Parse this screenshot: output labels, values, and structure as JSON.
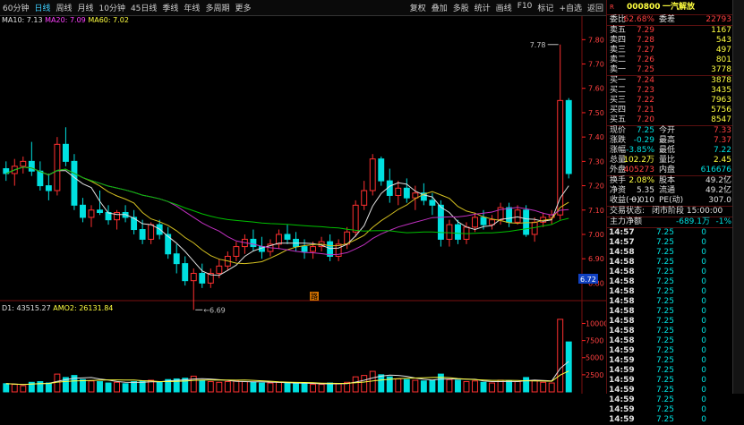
{
  "toolbar": {
    "left": [
      "60分钟",
      "日线",
      "周线",
      "月线",
      "10分钟",
      "45日线",
      "季线",
      "年线",
      "多周期",
      "更多"
    ],
    "active_index": 1,
    "right": [
      "复权",
      "叠加",
      "多股",
      "统计",
      "画线",
      "F10",
      "标记",
      "+自选",
      "返回"
    ]
  },
  "ma_legend": {
    "ma10": "MA10: 7.13",
    "ma20": "MA20: 7.09",
    "ma60": "MA60: 7.02"
  },
  "vol_legend": {
    "vol": "D1: 43515.27",
    "amo": "AMO2: 26131.84"
  },
  "colors": {
    "up": "#ff3030",
    "down": "#00e0e0",
    "ma10": "#e0e0e0",
    "ma20": "#d4c020",
    "ma60": "#00c000",
    "ma120": "#c030c0",
    "axis": "#ff2020"
  },
  "price_axis": {
    "labels": [
      "7.80",
      "7.70",
      "7.60",
      "7.50",
      "7.40",
      "7.30",
      "7.20",
      "7.10",
      "7.00",
      "6.90",
      "6.80"
    ],
    "min": 6.75,
    "max": 7.86
  },
  "vol_axis": {
    "labels": [
      "10000",
      "7500",
      "5000",
      "2500"
    ],
    "max": 11500
  },
  "annotations": {
    "high": "7.78",
    "low": "6.69",
    "current": "6.72",
    "marker": "路"
  },
  "candles": [
    [
      7.27,
      7.3,
      7.22,
      7.25,
      1200
    ],
    [
      7.25,
      7.31,
      7.2,
      7.28,
      1100
    ],
    [
      7.28,
      7.32,
      7.25,
      7.3,
      900
    ],
    [
      7.3,
      7.38,
      7.24,
      7.26,
      1400
    ],
    [
      7.26,
      7.3,
      7.18,
      7.2,
      1500
    ],
    [
      7.2,
      7.25,
      7.14,
      7.18,
      1300
    ],
    [
      7.18,
      7.4,
      7.16,
      7.37,
      2600
    ],
    [
      7.37,
      7.44,
      7.28,
      7.3,
      2100
    ],
    [
      7.3,
      7.33,
      7.1,
      7.12,
      2400
    ],
    [
      7.12,
      7.15,
      7.05,
      7.07,
      1800
    ],
    [
      7.07,
      7.12,
      7.03,
      7.1,
      1600
    ],
    [
      7.1,
      7.18,
      7.08,
      7.09,
      1500
    ],
    [
      7.09,
      7.12,
      7.04,
      7.06,
      1300
    ],
    [
      7.06,
      7.1,
      7.02,
      7.09,
      1400
    ],
    [
      7.09,
      7.12,
      7.05,
      7.07,
      1200
    ],
    [
      7.07,
      7.1,
      7.0,
      7.02,
      1500
    ],
    [
      7.02,
      7.06,
      6.96,
      6.98,
      1600
    ],
    [
      6.98,
      7.05,
      6.96,
      7.04,
      1700
    ],
    [
      7.04,
      7.06,
      6.98,
      7.0,
      1400
    ],
    [
      7.0,
      7.03,
      6.9,
      6.92,
      1800
    ],
    [
      6.92,
      6.96,
      6.84,
      6.88,
      1900
    ],
    [
      6.88,
      6.91,
      6.79,
      6.81,
      2000
    ],
    [
      6.81,
      6.86,
      6.69,
      6.84,
      2300
    ],
    [
      6.84,
      6.88,
      6.78,
      6.8,
      1700
    ],
    [
      6.8,
      6.86,
      6.78,
      6.84,
      1500
    ],
    [
      6.84,
      6.9,
      6.82,
      6.87,
      1400
    ],
    [
      6.87,
      6.93,
      6.85,
      6.91,
      1500
    ],
    [
      6.91,
      6.97,
      6.89,
      6.95,
      1600
    ],
    [
      6.95,
      7.0,
      6.92,
      6.98,
      1500
    ],
    [
      6.98,
      7.02,
      6.93,
      6.95,
      1400
    ],
    [
      6.95,
      6.99,
      6.9,
      6.93,
      1300
    ],
    [
      6.93,
      6.98,
      6.91,
      6.96,
      1300
    ],
    [
      6.96,
      7.02,
      6.94,
      7.0,
      1400
    ],
    [
      7.0,
      7.04,
      6.96,
      6.98,
      1300
    ],
    [
      6.98,
      7.01,
      6.93,
      6.95,
      1200
    ],
    [
      6.95,
      6.98,
      6.9,
      6.93,
      1200
    ],
    [
      6.93,
      6.97,
      6.9,
      6.95,
      1100
    ],
    [
      6.95,
      6.99,
      6.93,
      6.97,
      1100
    ],
    [
      6.97,
      7.0,
      6.89,
      6.91,
      1300
    ],
    [
      6.91,
      6.98,
      6.89,
      6.96,
      1200
    ],
    [
      6.96,
      7.03,
      6.94,
      7.01,
      1400
    ],
    [
      7.01,
      7.14,
      6.99,
      7.12,
      2200
    ],
    [
      7.12,
      7.22,
      7.1,
      7.18,
      2400
    ],
    [
      7.18,
      7.33,
      7.16,
      7.31,
      3000
    ],
    [
      7.31,
      7.32,
      7.2,
      7.22,
      2500
    ],
    [
      7.22,
      7.27,
      7.13,
      7.16,
      2200
    ],
    [
      7.16,
      7.22,
      7.12,
      7.19,
      1900
    ],
    [
      7.19,
      7.23,
      7.13,
      7.15,
      1800
    ],
    [
      7.15,
      7.2,
      7.1,
      7.17,
      1700
    ],
    [
      7.17,
      7.21,
      7.12,
      7.14,
      1600
    ],
    [
      7.14,
      7.17,
      7.08,
      7.12,
      1700
    ],
    [
      7.12,
      7.14,
      6.95,
      6.98,
      2600
    ],
    [
      6.98,
      7.06,
      6.95,
      7.04,
      1800
    ],
    [
      7.04,
      7.06,
      6.96,
      6.98,
      1700
    ],
    [
      6.98,
      7.05,
      6.96,
      7.03,
      1500
    ],
    [
      7.03,
      7.09,
      7.01,
      7.07,
      1600
    ],
    [
      7.07,
      7.1,
      7.02,
      7.04,
      1400
    ],
    [
      7.04,
      7.08,
      7.02,
      7.06,
      1300
    ],
    [
      7.06,
      7.13,
      7.04,
      7.11,
      1700
    ],
    [
      7.11,
      7.13,
      7.03,
      7.05,
      1600
    ],
    [
      7.05,
      7.12,
      7.04,
      7.1,
      1500
    ],
    [
      7.1,
      7.12,
      6.99,
      7.0,
      2100
    ],
    [
      7.0,
      7.07,
      6.97,
      7.05,
      1700
    ],
    [
      7.05,
      7.09,
      7.03,
      7.07,
      1400
    ],
    [
      7.07,
      7.1,
      7.04,
      7.08,
      1300
    ],
    [
      7.08,
      7.78,
      7.06,
      7.55,
      10600
    ],
    [
      7.55,
      7.56,
      7.23,
      7.25,
      7300
    ]
  ],
  "panel": {
    "code": "000800",
    "name": "一汽解放",
    "weibi_label": "委比",
    "weibi_value": "62.68%",
    "weicha_label": "委差",
    "weicha_value": "22793",
    "asks": [
      {
        "label": "卖五",
        "price": "7.29",
        "vol": "1167"
      },
      {
        "label": "卖四",
        "price": "7.28",
        "vol": "543"
      },
      {
        "label": "卖三",
        "price": "7.27",
        "vol": "497"
      },
      {
        "label": "卖二",
        "price": "7.26",
        "vol": "801"
      },
      {
        "label": "卖一",
        "price": "7.25",
        "vol": "3778"
      }
    ],
    "bids": [
      {
        "label": "买一",
        "price": "7.24",
        "vol": "3878"
      },
      {
        "label": "买二",
        "price": "7.23",
        "vol": "3435"
      },
      {
        "label": "买三",
        "price": "7.22",
        "vol": "7963"
      },
      {
        "label": "买四",
        "price": "7.21",
        "vol": "5756"
      },
      {
        "label": "买五",
        "price": "7.20",
        "vol": "8547"
      }
    ],
    "stats": [
      {
        "l1": "现价",
        "v1": "7.25",
        "l2": "今开",
        "v2": "7.33",
        "c1": "green",
        "c2": "red"
      },
      {
        "l1": "涨跌",
        "v1": "-0.29",
        "l2": "最高",
        "v2": "7.37",
        "c1": "green",
        "c2": "red"
      },
      {
        "l1": "涨幅",
        "v1": "-3.85%",
        "l2": "最低",
        "v2": "7.22",
        "c1": "green",
        "c2": "green"
      },
      {
        "l1": "总量",
        "v1": "102.2万",
        "l2": "量比",
        "v2": "2.45",
        "c1": "yellow",
        "c2": "yellow"
      },
      {
        "l1": "外盘",
        "v1": "405273",
        "l2": "内盘",
        "v2": "616676",
        "c1": "red",
        "c2": "green"
      }
    ],
    "stats2": [
      {
        "l1": "换手",
        "v1": "2.08%",
        "l2": "股本",
        "v2": "49.2亿",
        "c1": "yellow",
        "c2": "white"
      },
      {
        "l1": "净资",
        "v1": "5.35",
        "l2": "流通",
        "v2": "49.2亿",
        "c1": "white",
        "c2": "white"
      },
      {
        "l1": "收益(一)",
        "v1": "0.010",
        "l2": "PE(动)",
        "v2": "307.0",
        "c1": "white",
        "c2": "white"
      }
    ],
    "trade_status_label": "交易状态:",
    "trade_status_value": "闭市阶段 15:00:00",
    "main_flow_label": "主力净额",
    "main_flow_value": "-689.1万",
    "main_flow_pct": "-1%",
    "ticks": [
      {
        "t": "14:57",
        "p": "7.25",
        "v": "0"
      },
      {
        "t": "14:57",
        "p": "7.25",
        "v": "0"
      },
      {
        "t": "14:58",
        "p": "7.25",
        "v": "0"
      },
      {
        "t": "14:58",
        "p": "7.25",
        "v": "0"
      },
      {
        "t": "14:58",
        "p": "7.25",
        "v": "0"
      },
      {
        "t": "14:58",
        "p": "7.25",
        "v": "0"
      },
      {
        "t": "14:58",
        "p": "7.25",
        "v": "0"
      },
      {
        "t": "14:58",
        "p": "7.25",
        "v": "0"
      },
      {
        "t": "14:58",
        "p": "7.25",
        "v": "0"
      },
      {
        "t": "14:58",
        "p": "7.25",
        "v": "0"
      },
      {
        "t": "14:58",
        "p": "7.25",
        "v": "0"
      },
      {
        "t": "14:58",
        "p": "7.25",
        "v": "0"
      },
      {
        "t": "14:59",
        "p": "7.25",
        "v": "0"
      },
      {
        "t": "14:59",
        "p": "7.25",
        "v": "0"
      },
      {
        "t": "14:59",
        "p": "7.25",
        "v": "0"
      },
      {
        "t": "14:59",
        "p": "7.25",
        "v": "0"
      },
      {
        "t": "14:59",
        "p": "7.25",
        "v": "0"
      },
      {
        "t": "14:59",
        "p": "7.25",
        "v": "0"
      },
      {
        "t": "14:59",
        "p": "7.25",
        "v": "0"
      },
      {
        "t": "14:59",
        "p": "7.25",
        "v": "0"
      }
    ]
  }
}
